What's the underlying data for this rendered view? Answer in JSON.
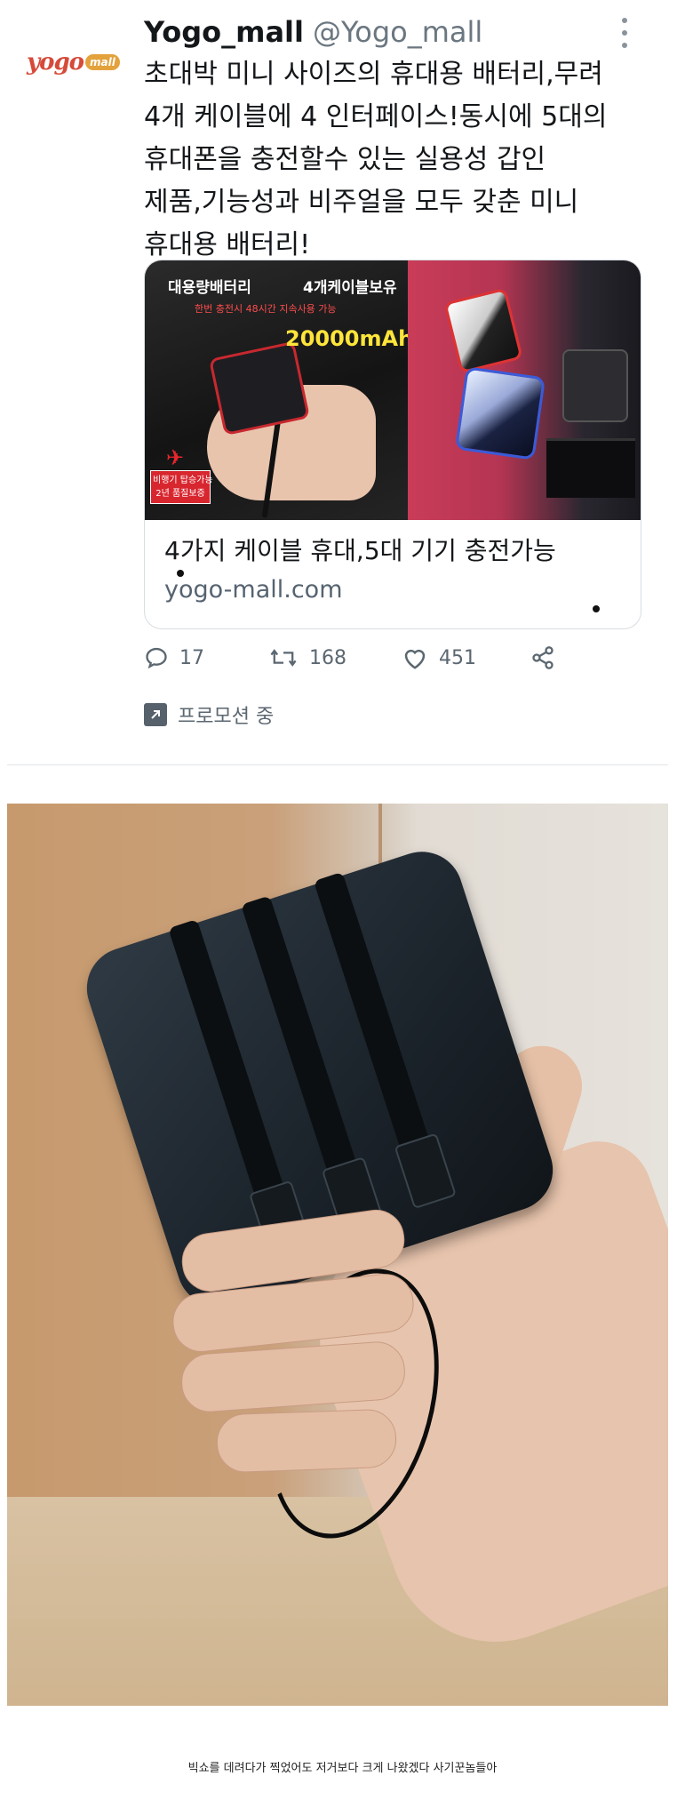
{
  "tweet": {
    "logo_text": "yogo",
    "logo_badge": "mall",
    "display_name": "Yogo_mall",
    "handle": "@Yogo_mall",
    "text_lines": [
      "초대박 미니 사이즈의 휴대용 배터리,무려",
      "4개 케이블에 4 인터페이스!동시에 5대의",
      "휴대폰을 충전할수 있는 실용성 갑인",
      "제품,기능성과 비주얼을 모두 갖춘 미니",
      "휴대용 배터리!"
    ]
  },
  "card": {
    "image_labels": {
      "large_capacity": "대용량배터리",
      "four_cables": "4개케이블보유",
      "subtitle": "한번 충전시 48시간 지속사용 가능",
      "capacity": "20000mAh",
      "badge_line1": "비행기 탑승가능",
      "badge_line2": "2년 품질보증"
    },
    "title": "4가지 케이블 휴대,5대 기기 충전가능",
    "url": "yogo-mall.com"
  },
  "actions": {
    "replies": "17",
    "retweets": "168",
    "likes": "451"
  },
  "promoted_label": "프로모션 중",
  "caption": "빅쇼를 데려다가 찍었어도 저거보다 크게 나왔겠다 사기꾼놈들아",
  "colors": {
    "text": "#14171a",
    "muted": "#5b6770",
    "border": "#d7dde2",
    "logo_red": "#d64a3a",
    "logo_orange": "#e3a23c"
  }
}
